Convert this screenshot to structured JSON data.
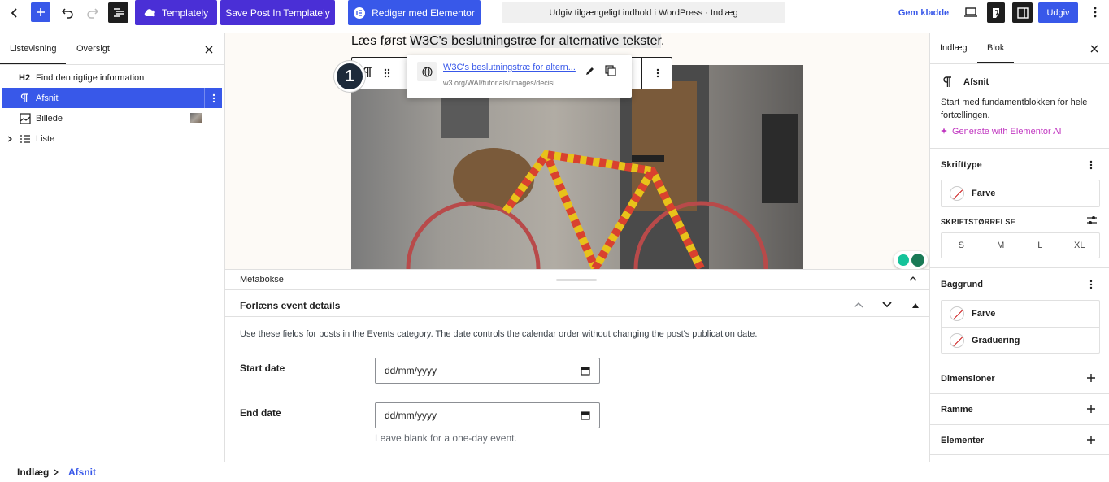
{
  "topbar": {
    "templately_label": "Templately",
    "save_templately_label": "Save Post In Templately",
    "elementor_label": "Rediger med Elementor",
    "document_title": "Udgiv tilgængeligt indhold i WordPress · Indlæg",
    "save_draft_label": "Gem kladde",
    "publish_label": "Udgiv"
  },
  "left_panel": {
    "tabs": [
      "Listevisning",
      "Oversigt"
    ],
    "items": [
      {
        "badge": "H2",
        "label": "Find den rigtige information"
      },
      {
        "label": "Afsnit"
      },
      {
        "label": "Billede"
      },
      {
        "label": "Liste"
      }
    ]
  },
  "canvas": {
    "paragraph_prefix": "Læs først ",
    "paragraph_link": "W3C's beslutningstræ for alternative tekster",
    "paragraph_suffix": ".",
    "link_popover": {
      "title": "W3C's beslutningstræ for altern...",
      "url": "w3.org/WAI/tutorials/images/decisi..."
    },
    "step_badge": "1"
  },
  "metabox": {
    "bar_label": "Metabokse",
    "section_title": "Forlæns event details",
    "description": "Use these fields for posts in the Events category. The date controls the calendar order without changing the post's publication date.",
    "start_label": "Start date",
    "start_placeholder": "dd/mm/yyyy",
    "end_label": "End date",
    "end_placeholder": "dd/mm/yyyy",
    "end_help": "Leave blank for a one-day event."
  },
  "right_panel": {
    "tabs": [
      "Indlæg",
      "Blok"
    ],
    "block_name": "Afsnit",
    "block_description": "Start med fundamentblokken for hele fortællingen.",
    "ai_link": "Generate with Elementor AI",
    "typography_title": "Skrifttype",
    "color_label": "Farve",
    "font_size_label": "SKRIFTSTØRRELSE",
    "font_sizes": [
      "S",
      "M",
      "L",
      "XL"
    ],
    "background_title": "Baggrund",
    "bg_color_label": "Farve",
    "gradient_label": "Graduering",
    "dimensions_title": "Dimensioner",
    "border_title": "Ramme",
    "elements_title": "Elementer"
  },
  "footer": {
    "crumb_root": "Indlæg",
    "crumb_current": "Afsnit"
  },
  "colors": {
    "accent": "#3858e9",
    "templately": "#4a2fd6",
    "elementor_ai": "#c036c0"
  }
}
